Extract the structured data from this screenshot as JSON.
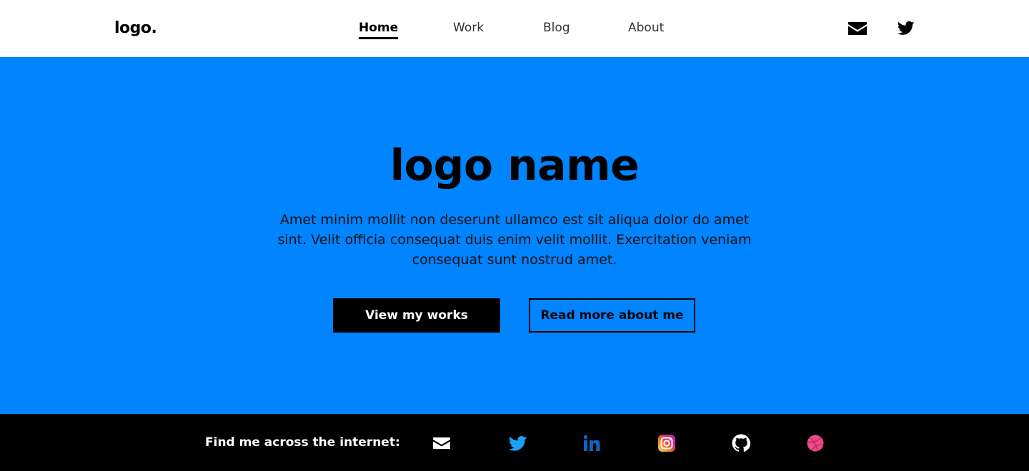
{
  "header": {
    "logo": "logo.",
    "nav": [
      {
        "label": "Home",
        "active": true
      },
      {
        "label": "Work",
        "active": false
      },
      {
        "label": "Blog",
        "active": false
      },
      {
        "label": "About",
        "active": false
      }
    ],
    "icons": [
      "mail-icon",
      "twitter-icon"
    ]
  },
  "hero": {
    "title": "logo name",
    "description": "Amet minim mollit non deserunt ullamco est sit aliqua dolor do amet sint. Velit officia consequat duis enim velit mollit. Exercitation veniam consequat sunt nostrud amet.",
    "primary_button": "View my works",
    "secondary_button": "Read more about me",
    "background_color": "#0084ff"
  },
  "footer": {
    "label": "Find me across the internet:",
    "social_icons": [
      "mail-icon",
      "twitter-icon",
      "linkedin-icon",
      "instagram-icon",
      "github-icon",
      "dribbble-icon"
    ],
    "background_color": "#000000"
  }
}
